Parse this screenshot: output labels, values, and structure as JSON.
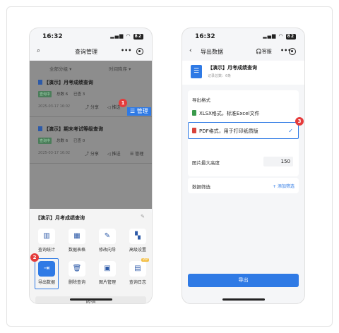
{
  "left_phone": {
    "status": {
      "time": "16:32",
      "battery": "82"
    },
    "nav": {
      "title": "查询管理"
    },
    "filters": {
      "group": "全部分组 ▾",
      "sort": "时间降序 ▾"
    },
    "cards": [
      {
        "title": "【演示】月考成绩查询",
        "badge": "查询中",
        "stat1": "总数 6",
        "stat2": "已查 3",
        "date": "2025-03-17 16:02",
        "share": "分享",
        "push": "推送",
        "manage": "管理"
      },
      {
        "title": "【演示】期末考试等级查询",
        "badge": "查询中",
        "stat1": "总数 6",
        "stat2": "已查 0",
        "date": "2025-03-17 16:02",
        "share": "分享",
        "push": "推送",
        "manage": "管理"
      }
    ],
    "sheet": {
      "title": "【演示】月考成绩查询",
      "items": [
        {
          "label": "查询统计",
          "icon": "bar-chart-icon",
          "glyph": "▥"
        },
        {
          "label": "数据表格",
          "icon": "table-icon",
          "glyph": "▦"
        },
        {
          "label": "修改向导",
          "icon": "edit-icon",
          "glyph": "✎"
        },
        {
          "label": "高级设置",
          "icon": "settings-grid-icon",
          "glyph": "▚"
        },
        {
          "label": "导出数据",
          "icon": "export-icon",
          "glyph": "⇥"
        },
        {
          "label": "删除查询",
          "icon": "trash-icon",
          "glyph": "🗑"
        },
        {
          "label": "图片管理",
          "icon": "image-icon",
          "glyph": "▣"
        },
        {
          "label": "查询日志",
          "icon": "log-icon",
          "glyph": "▤"
        }
      ],
      "vip_badge": "VIP",
      "cancel": "取消"
    },
    "step1": "1",
    "step1_label": "☰ 管理",
    "step2": "2"
  },
  "right_phone": {
    "status": {
      "time": "16:32",
      "battery": "82"
    },
    "nav": {
      "title": "导出数据",
      "service": "客服"
    },
    "header": {
      "title": "【演示】月考成绩查询",
      "subtitle": "记录总数：6条"
    },
    "format_section": {
      "title": "导出格式",
      "options": [
        "XLSX格式，标准Excel文件",
        "PDF格式，用于打印纸质版"
      ]
    },
    "row_height": {
      "label": "图片最大高度",
      "value": "150"
    },
    "filter_section": {
      "title": "数据筛选",
      "add": "+ 添加筛选"
    },
    "export_button": "导出",
    "step3": "3"
  },
  "colors": {
    "primary": "#2f7ae5",
    "step": "#e53b3b",
    "excel": "#3a9a4b",
    "pdf": "#d8433b"
  }
}
